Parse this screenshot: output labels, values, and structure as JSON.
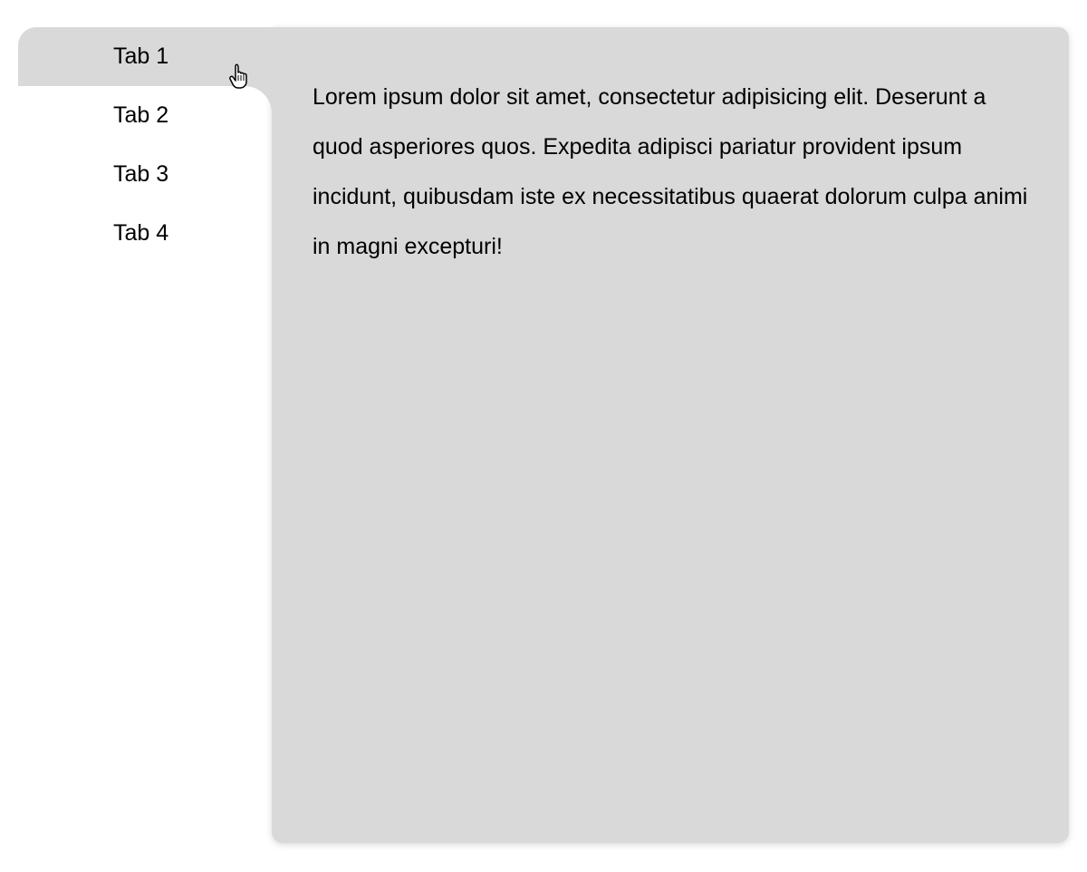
{
  "tabs": {
    "items": [
      {
        "label": "Tab 1",
        "active": true
      },
      {
        "label": "Tab 2",
        "active": false
      },
      {
        "label": "Tab 3",
        "active": false
      },
      {
        "label": "Tab 4",
        "active": false
      }
    ]
  },
  "content": {
    "body": "Lorem ipsum dolor sit amet, consectetur adipisicing elit. Deserunt a quod asperiores quos. Expedita adipisci pariatur provident ipsum incidunt, quibusdam iste ex necessitatibus quaerat dolorum culpa animi in magni excepturi!"
  }
}
